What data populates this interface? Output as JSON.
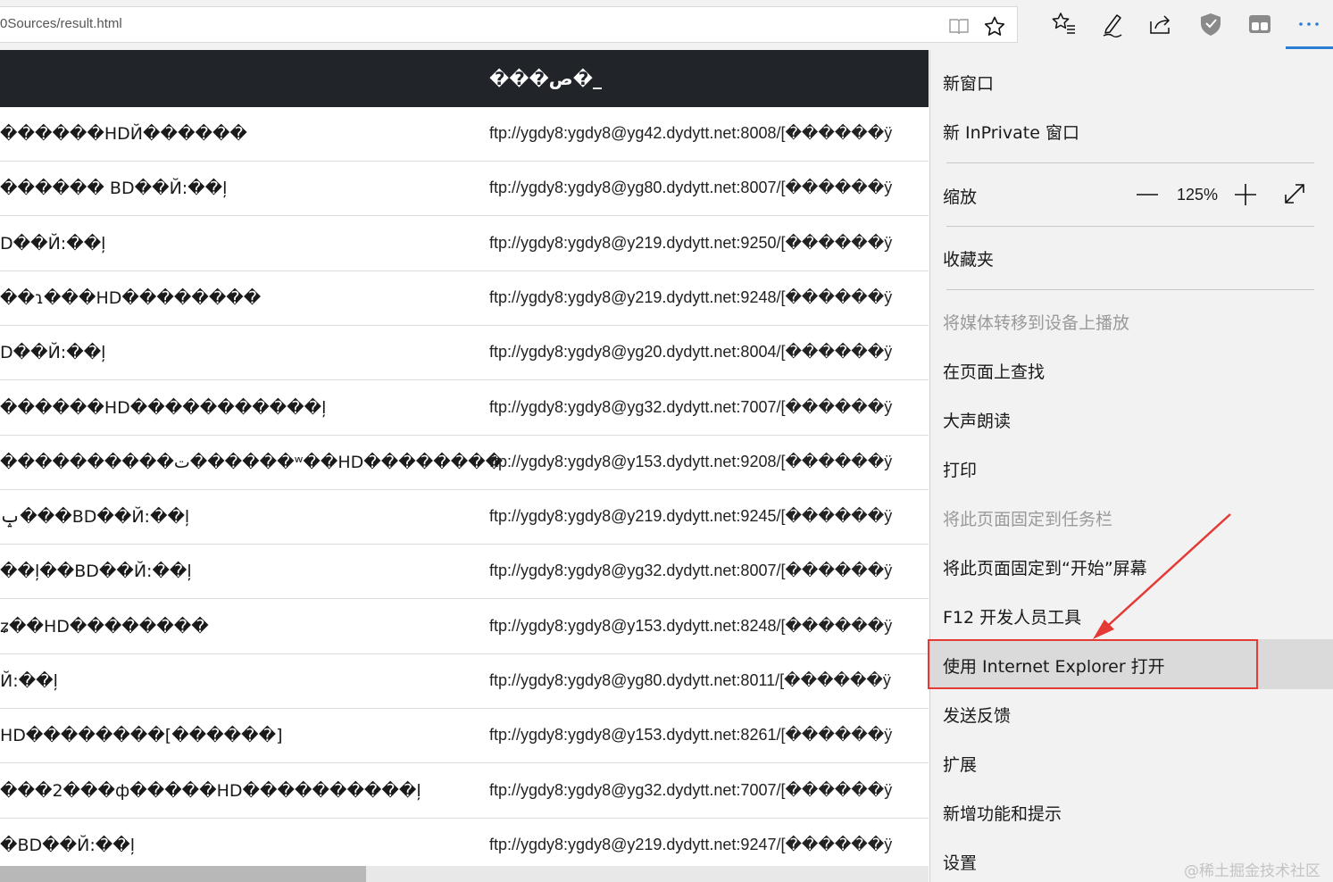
{
  "address_bar": {
    "url_text": "0Sources/result.html"
  },
  "icons": {
    "reading_view": "reading-view-icon",
    "favorite": "star-icon",
    "favorites_hub": "favorites-hub-icon",
    "pen": "pen-icon",
    "share": "share-icon",
    "shield": "shield-extension-icon",
    "tabs": "tab-sets-icon",
    "more": "more-icon"
  },
  "table": {
    "header": "���ص�_",
    "rows": [
      {
        "name": "������HDЙ������",
        "url": "ftp://ygdy8:ygdy8@yg42.dydytt.net:8008/[������ӱ"
      },
      {
        "name": "������    BD��Й꞉��ļ",
        "url": "ftp://ygdy8:ygdy8@yg80.dydytt.net:8007/[������ӱ"
      },
      {
        "name": "D��Й꞉��ļ",
        "url": "ftp://ygdy8:ygdy8@y219.dydytt.net:9250/[������ӱ"
      },
      {
        "name": "��ɿ���HD��������",
        "url": "ftp://ygdy8:ygdy8@y219.dydytt.net:9248/[������ӱ"
      },
      {
        "name": "D��Й꞉��ļ",
        "url": "ftp://ygdy8:ygdy8@yg20.dydytt.net:8004/[������ӱ"
      },
      {
        "name": "������HD�����������ļ",
        "url": "ftp://ygdy8:ygdy8@yg32.dydytt.net:7007/[������ӱ"
      },
      {
        "name": "����������ت������ʷ��HD��������",
        "url": "ftp://ygdy8:ygdy8@y153.dydytt.net:9208/[������ӱ"
      },
      {
        "name": "ݒ���BD��Й꞉��ļ",
        "url": "ftp://ygdy8:ygdy8@y219.dydytt.net:9245/[������ӱ"
      },
      {
        "name": "��ļ��BD��Й꞉��ļ",
        "url": "ftp://ygdy8:ygdy8@yg32.dydytt.net:8007/[������ӱ"
      },
      {
        "name": "ʑ��HD��������",
        "url": "ftp://ygdy8:ygdy8@y153.dydytt.net:8248/[������ӱ"
      },
      {
        "name": "Й꞉��ļ",
        "url": "ftp://ygdy8:ygdy8@yg80.dydytt.net:8011/[������ӱ"
      },
      {
        "name": "HD��������[������]",
        "url": "ftp://ygdy8:ygdy8@y153.dydytt.net:8261/[������ӱ"
      },
      {
        "name": "���2���ф�����HD����������ļ",
        "url": "ftp://ygdy8:ygdy8@yg32.dydytt.net:7007/[������ӱ"
      },
      {
        "name": "�BD��Й꞉��ļ",
        "url": "ftp://ygdy8:ygdy8@y219.dydytt.net:9247/[������ӱ"
      }
    ]
  },
  "menu": {
    "new_window": "新窗口",
    "new_inprivate": "新 InPrivate 窗口",
    "zoom_label": "缩放",
    "zoom_value": "125%",
    "zoom_minus": "—",
    "zoom_plus": "+",
    "favorites": "收藏夹",
    "cast_media": "将媒体转移到设备上播放",
    "find_on_page": "在页面上查找",
    "read_aloud": "大声朗读",
    "print": "打印",
    "pin_taskbar": "将此页面固定到任务栏",
    "pin_start": "将此页面固定到“开始”屏幕",
    "dev_tools": "F12 开发人员工具",
    "open_ie": "使用 Internet Explorer 打开",
    "feedback": "发送反馈",
    "extensions": "扩展",
    "whats_new": "新增功能和提示",
    "settings": "设置"
  },
  "annotation": {
    "color": "#e53935"
  },
  "watermark": "@稀土掘金技术社区"
}
